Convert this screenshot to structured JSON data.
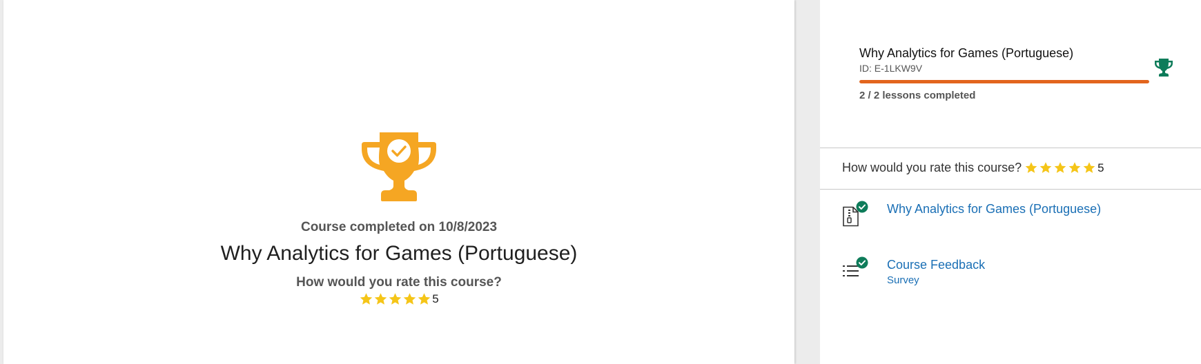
{
  "main": {
    "completed_text": "Course completed on 10/8/2023",
    "course_title": "Why Analytics for Games (Portuguese)",
    "rate_question": "How would you rate this course?",
    "rating_value": "5",
    "rating_stars": 5
  },
  "panel": {
    "course_title": "Why Analytics for Games (Portuguese)",
    "course_id": "ID: E-1LKW9V",
    "progress_fraction": 1.0,
    "lessons_text": "2 / 2 lessons completed",
    "rate_question": "How would you rate this course?",
    "rating_value": "5",
    "items": [
      {
        "title": "Why Analytics for Games (Portuguese)",
        "subtitle": "",
        "icon": "zip-file-icon",
        "status": "completed"
      },
      {
        "title": "Course Feedback",
        "subtitle": "Survey",
        "icon": "list-icon",
        "status": "completed"
      }
    ]
  },
  "colors": {
    "trophy_orange": "#f5a623",
    "trophy_green": "#0e7c5a",
    "progress": "#e2651d",
    "star": "#f5c518",
    "link": "#1a6fb5",
    "check_green": "#0e7c5a"
  }
}
